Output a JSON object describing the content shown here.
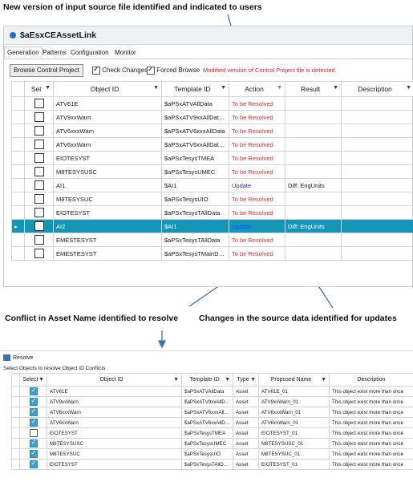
{
  "callouts": {
    "top": "New version of input source file identified and indicated to users",
    "left": "Conflict in Asset Name identified to resolve",
    "right": "Changes in the source data identified for updates"
  },
  "window": {
    "title": "$aEsxCEAssetLink"
  },
  "tabs": [
    "Generation",
    "Patterns",
    "Configuration",
    "Monitor"
  ],
  "toolbar": {
    "browse_label": "Browse Control Project",
    "check_changes_label": "Check Changes",
    "check_changes_checked": true,
    "forced_browse_label": "Forced Browse",
    "forced_browse_checked": true,
    "warning": "Modified version of Control Project file is detected"
  },
  "grid": {
    "columns": [
      "Sel",
      "Object ID",
      "Template ID",
      "Action",
      "Result",
      "Description"
    ],
    "rows": [
      {
        "object": "ATV61E",
        "template": "$aPSxATVAllData",
        "action": "To be Resolved",
        "result": ""
      },
      {
        "object": "ATV9xxWarn",
        "template": "$aPSxATV9xxAllDataa...",
        "action": "To be Resolved",
        "result": ""
      },
      {
        "object": "ATV6xxxWarn",
        "template": "$aPSxATV6xxxAllData",
        "action": "To be Resolved",
        "result": ""
      },
      {
        "object": "ATV6xxWarn",
        "template": "$aPSxATV6xxAllDataa...",
        "action": "To be Resolved",
        "result": ""
      },
      {
        "object": "EIOTESYST",
        "template": "$aPSxTesysTMEA",
        "action": "To be Resolved",
        "result": ""
      },
      {
        "object": "M8TESYSUSC",
        "template": "$aPSxTesysUMEC",
        "action": "To be Resolved",
        "result": ""
      },
      {
        "object": "AI1",
        "template": "$AI1",
        "action": "Update",
        "result": "Diff: EngUnits"
      },
      {
        "object": "M8TESYSUC",
        "template": "$aPSxTesysUIO",
        "action": "To be Resolved",
        "result": ""
      },
      {
        "object": "EIOTESYST",
        "template": "$aPSxTesysTAllData",
        "action": "To be Resolved",
        "result": ""
      },
      {
        "object": "AI2",
        "template": "$AI1",
        "action": "Update",
        "result": "Diff: EngUnits",
        "selected": true
      },
      {
        "object": "EMESTESYST",
        "template": "$aPSxTesysTAllData",
        "action": "To be Resolved",
        "result": ""
      },
      {
        "object": "EMESTESYST",
        "template": "$aPSxTesysTMainData",
        "action": "To be Resolved",
        "result": ""
      }
    ]
  },
  "resolve": {
    "title": "Resolve",
    "subtitle": "Select Objects to resolve Object ID Conflicts",
    "columns": [
      "Select",
      "Object ID",
      "Template ID",
      "Type",
      "Proposed Name",
      "Description"
    ],
    "rows": [
      {
        "checked": true,
        "object": "ATV61E",
        "template": "$aPSxATVAllData",
        "type": "Asset",
        "proposed": "ATV61E_01",
        "desc": "This object exist more than once"
      },
      {
        "checked": true,
        "object": "ATV9xxWarn",
        "template": "$aPSxATV9xxAllData...",
        "type": "Asset",
        "proposed": "ATV9xxWarn_01",
        "desc": "This object exist more than once"
      },
      {
        "checked": true,
        "object": "ATV6xxxWarn",
        "template": "$aPSxATV6xxxAllData",
        "type": "Asset",
        "proposed": "ATV6xxxWarn_01",
        "desc": "This object exist more than once"
      },
      {
        "checked": true,
        "object": "ATV6xxWarn",
        "template": "$aPSxATV6xxAllData...",
        "type": "Asset",
        "proposed": "ATV6xxWarn_01",
        "desc": "This object exist more than once"
      },
      {
        "checked": false,
        "object": "EIOTESYST",
        "template": "$aPSxTesysTMEA",
        "type": "Asset",
        "proposed": "EIOTESYST_01",
        "desc": "This object exist more than once"
      },
      {
        "checked": true,
        "object": "M8TESYSUSC",
        "template": "$aPSxTesysUMEC",
        "type": "Asset",
        "proposed": "M8TESYSUSC_01",
        "desc": "This object exist more than once"
      },
      {
        "checked": true,
        "object": "M8TESYSUC",
        "template": "$aPSxTesysUIO",
        "type": "Asset",
        "proposed": "M8TESYSUC_01",
        "desc": "This object exist more than once"
      },
      {
        "checked": true,
        "object": "EIOTESYST",
        "template": "$aPSxTesysTAllData",
        "type": "Asset",
        "proposed": "EIOTESYST_01",
        "desc": "This object exist more than once"
      }
    ]
  },
  "colors": {
    "selection": "#1596b6",
    "warning": "#d62728",
    "arrow": "#3b6fb6"
  }
}
